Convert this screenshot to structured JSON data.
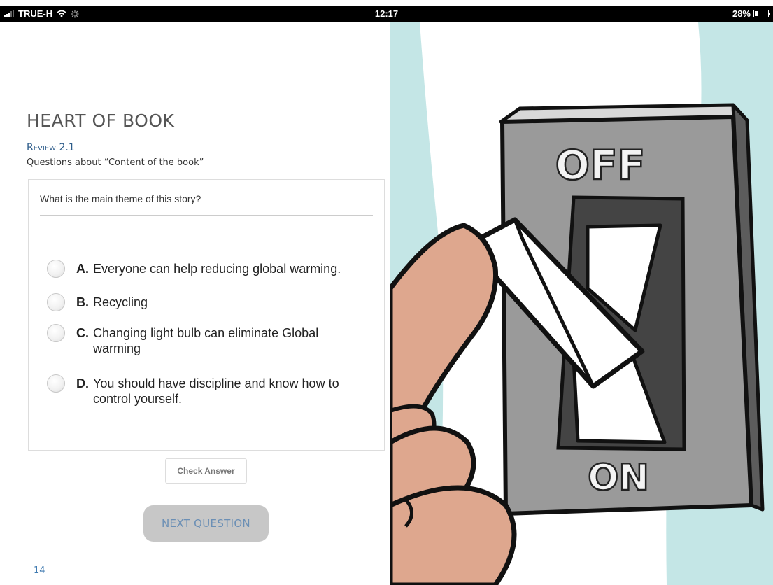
{
  "status_bar": {
    "carrier": "TRUE-H",
    "time": "12:17",
    "battery": "28%",
    "battery_level": 0.28
  },
  "book": {
    "title": "HEART OF BOOK",
    "review_label": "Review 2.1",
    "review_subtitle": "Questions about “Content of the book”"
  },
  "quiz": {
    "question": "What is the main theme of this story?",
    "options": [
      {
        "letter": "A.",
        "text": "Everyone can help reducing global warming."
      },
      {
        "letter": "B.",
        "text": "Recycling"
      },
      {
        "letter": "C.",
        "text": "Changing light bulb can eliminate Global warming"
      },
      {
        "letter": "D.",
        "text": "You should have discipline and know how to control yourself."
      }
    ],
    "check_answer_label": "Check Answer",
    "next_question_label": "NEXT QUESTION"
  },
  "page_number": "14",
  "illustration": {
    "off_label": "OFF",
    "on_label": "ON",
    "colors": {
      "teal_bg": "#c4e6e6",
      "plate": "#9a9a9a",
      "skin": "#dea78e"
    }
  }
}
